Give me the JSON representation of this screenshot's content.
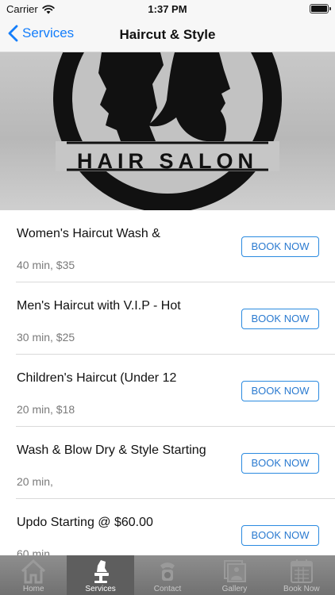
{
  "status_bar": {
    "carrier": "Carrier",
    "time": "1:37 PM",
    "battery_level": 1.0
  },
  "nav": {
    "back_label": "Services",
    "title": "Haircut & Style"
  },
  "hero": {
    "logo_text": "HAIR SALON"
  },
  "services": [
    {
      "name": "Women's Haircut  Wash &",
      "meta": "40 min, $35",
      "button": "BOOK NOW"
    },
    {
      "name": "Men's Haircut with V.I.P - Hot",
      "meta": "30 min, $25",
      "button": "BOOK NOW"
    },
    {
      "name": "Children's  Haircut (Under 12",
      "meta": "20 min, $18",
      "button": "BOOK NOW"
    },
    {
      "name": "Wash & Blow Dry & Style Starting",
      "meta": "20 min,",
      "button": "BOOK NOW"
    },
    {
      "name": "Updo Starting @ $60.00",
      "meta": "60 min,",
      "button": "BOOK NOW"
    }
  ],
  "tabs": [
    {
      "label": "Home",
      "icon": "home-icon"
    },
    {
      "label": "Services",
      "icon": "barber-chair-icon",
      "active": true
    },
    {
      "label": "Contact",
      "icon": "phone-icon"
    },
    {
      "label": "Gallery",
      "icon": "photo-gallery-icon"
    },
    {
      "label": "Book Now",
      "icon": "calendar-icon"
    }
  ],
  "colors": {
    "accent": "#147efb",
    "tab_bar": "#7a7a7a",
    "tab_active": "#5e5e5e"
  }
}
